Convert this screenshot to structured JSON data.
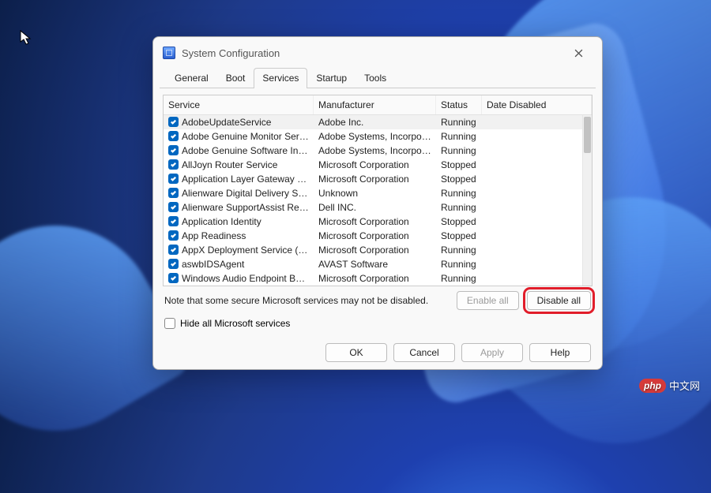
{
  "wallpaper": "windows-11-bloom",
  "dialog": {
    "title": "System Configuration",
    "tabs": [
      "General",
      "Boot",
      "Services",
      "Startup",
      "Tools"
    ],
    "active_tab_index": 2,
    "columns": {
      "service": "Service",
      "manufacturer": "Manufacturer",
      "status": "Status",
      "date_disabled": "Date Disabled"
    },
    "services": [
      {
        "name": "AdobeUpdateService",
        "mfr": "Adobe Inc.",
        "status": "Running",
        "date": "",
        "checked": true
      },
      {
        "name": "Adobe Genuine Monitor Service",
        "mfr": "Adobe Systems, Incorpora...",
        "status": "Running",
        "date": "",
        "checked": true
      },
      {
        "name": "Adobe Genuine Software Integri...",
        "mfr": "Adobe Systems, Incorpora...",
        "status": "Running",
        "date": "",
        "checked": true
      },
      {
        "name": "AllJoyn Router Service",
        "mfr": "Microsoft Corporation",
        "status": "Stopped",
        "date": "",
        "checked": true
      },
      {
        "name": "Application Layer Gateway Service",
        "mfr": "Microsoft Corporation",
        "status": "Stopped",
        "date": "",
        "checked": true
      },
      {
        "name": "Alienware Digital Delivery Services",
        "mfr": "Unknown",
        "status": "Running",
        "date": "",
        "checked": true
      },
      {
        "name": "Alienware SupportAssist Remedi...",
        "mfr": "Dell INC.",
        "status": "Running",
        "date": "",
        "checked": true
      },
      {
        "name": "Application Identity",
        "mfr": "Microsoft Corporation",
        "status": "Stopped",
        "date": "",
        "checked": true
      },
      {
        "name": "App Readiness",
        "mfr": "Microsoft Corporation",
        "status": "Stopped",
        "date": "",
        "checked": true
      },
      {
        "name": "AppX Deployment Service (AppX...",
        "mfr": "Microsoft Corporation",
        "status": "Running",
        "date": "",
        "checked": true
      },
      {
        "name": "aswbIDSAgent",
        "mfr": "AVAST Software",
        "status": "Running",
        "date": "",
        "checked": true
      },
      {
        "name": "Windows Audio Endpoint Builder",
        "mfr": "Microsoft Corporation",
        "status": "Running",
        "date": "",
        "checked": true
      }
    ],
    "note": "Note that some secure Microsoft services may not be disabled.",
    "enable_all": "Enable all",
    "disable_all": "Disable all",
    "hide_ms": "Hide all Microsoft services",
    "hide_ms_checked": false,
    "buttons": {
      "ok": "OK",
      "cancel": "Cancel",
      "apply": "Apply",
      "help": "Help"
    }
  },
  "highlight": "disable-all-button",
  "watermark": {
    "badge": "php",
    "text": "中文网"
  }
}
